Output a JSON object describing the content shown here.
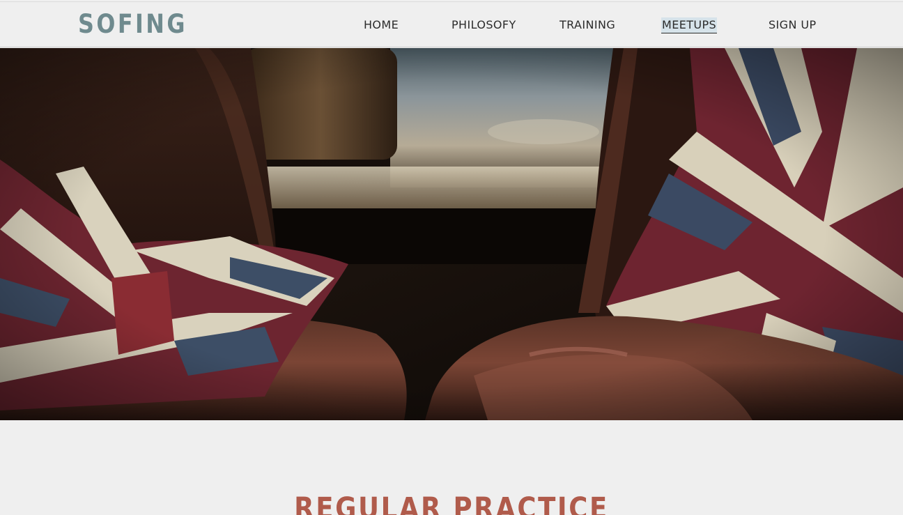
{
  "header": {
    "logo": "SOFING",
    "nav": [
      {
        "label": "HOME"
      },
      {
        "label": "PHILOSOFY"
      },
      {
        "label": "TRAINING"
      },
      {
        "label": "MEETUPS"
      },
      {
        "label": "SIGN UP"
      }
    ],
    "active_item": "MEETUPS"
  },
  "hero": {
    "image": "two-leather-chairs-with-union-jack-blankets"
  },
  "section": {
    "title": "REGULAR PRACTICE"
  },
  "colors": {
    "background": "#efefef",
    "logo": "#6f8a8e",
    "nav_text": "#2b2b2b",
    "active_highlight": "#d6e3ea",
    "section_title": "#b05b4b"
  }
}
